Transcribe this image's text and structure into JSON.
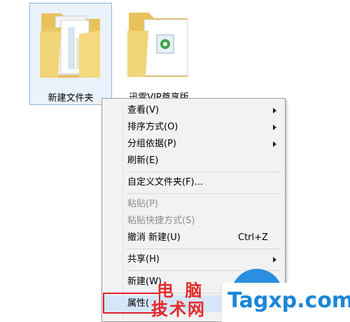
{
  "desktop": {
    "folder1_label": "新建文件夹",
    "folder2_label": "迅雷VIP尊享版"
  },
  "context_menu": {
    "view": "查看(V)",
    "sort_by": "排序方式(O)",
    "group_by": "分组依据(P)",
    "refresh": "刷新(E)",
    "customize_folder": "自定义文件夹(F)...",
    "paste": "粘贴(P)",
    "paste_shortcut": "粘贴快捷方式(S)",
    "undo_new": "撤消 新建(U)",
    "undo_shortcut": "Ctrl+Z",
    "share": "共享(H)",
    "new": "新建(W)",
    "properties": "属性("
  },
  "watermark": {
    "line1": "电 脑",
    "line2": "技术网",
    "site": "Tagxp.com"
  },
  "colors": {
    "highlight_box": "#e0202d",
    "watermark_red": "#e42b2b",
    "watermark_blue": "#1a86d8",
    "selection": "#8fb3e3"
  }
}
